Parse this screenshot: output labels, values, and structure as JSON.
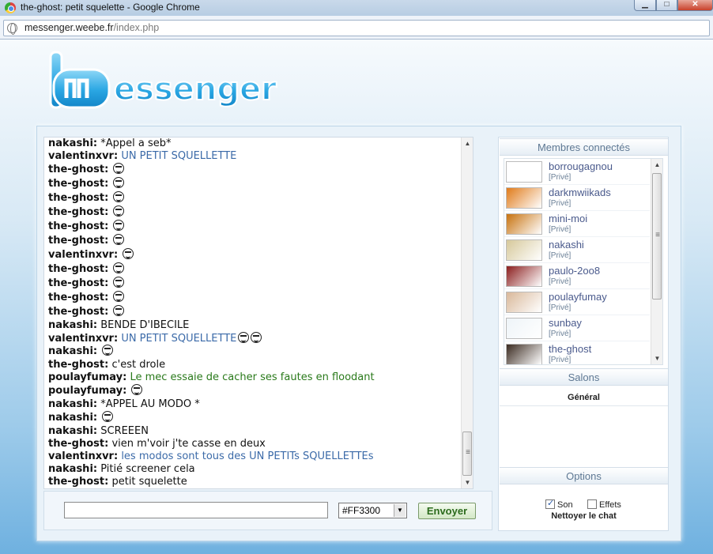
{
  "window": {
    "title": "the-ghost: petit squelette - Google Chrome",
    "minimize": "▁",
    "maximize": "□",
    "close": "✕"
  },
  "browser": {
    "url_host": "messenger.weebe.fr",
    "url_path": "/index.php"
  },
  "logo": {
    "text": "Messenger"
  },
  "chat": {
    "lines": [
      {
        "user": "nakashi:",
        "msg": "*Appel a seb*",
        "style": "",
        "smileys": 0
      },
      {
        "user": "valentinxvr:",
        "msg": "UN PETIT SQUELLETTE",
        "style": "blue",
        "smileys": 0
      },
      {
        "user": "the-ghost:",
        "msg": "",
        "style": "",
        "smileys": 1
      },
      {
        "user": "the-ghost:",
        "msg": "",
        "style": "",
        "smileys": 1
      },
      {
        "user": "the-ghost:",
        "msg": "",
        "style": "",
        "smileys": 1
      },
      {
        "user": "the-ghost:",
        "msg": "",
        "style": "",
        "smileys": 1
      },
      {
        "user": "the-ghost:",
        "msg": "",
        "style": "",
        "smileys": 1
      },
      {
        "user": "the-ghost:",
        "msg": "",
        "style": "",
        "smileys": 1
      },
      {
        "user": "valentinxvr:",
        "msg": "",
        "style": "",
        "smileys": 1
      },
      {
        "user": "the-ghost:",
        "msg": "",
        "style": "",
        "smileys": 1
      },
      {
        "user": "the-ghost:",
        "msg": "",
        "style": "",
        "smileys": 1
      },
      {
        "user": "the-ghost:",
        "msg": "",
        "style": "",
        "smileys": 1
      },
      {
        "user": "the-ghost:",
        "msg": "",
        "style": "",
        "smileys": 1
      },
      {
        "user": "nakashi:",
        "msg": "BENDE D'IBECILE",
        "style": "",
        "smileys": 0
      },
      {
        "user": "valentinxvr:",
        "msg": "UN PETIT SQUELLETTE",
        "style": "blue",
        "smileys": 2
      },
      {
        "user": "nakashi:",
        "msg": "",
        "style": "",
        "smileys": 1
      },
      {
        "user": "the-ghost:",
        "msg": "c'est drole",
        "style": "",
        "smileys": 0
      },
      {
        "user": "poulayfumay:",
        "msg": "Le mec essaie de cacher ses fautes en floodant",
        "style": "green",
        "smileys": 0
      },
      {
        "user": "poulayfumay:",
        "msg": "",
        "style": "",
        "smileys": 1
      },
      {
        "user": "nakashi:",
        "msg": "*APPEL AU MODO *",
        "style": "",
        "smileys": 0
      },
      {
        "user": "nakashi:",
        "msg": "",
        "style": "",
        "smileys": 1
      },
      {
        "user": "nakashi:",
        "msg": "SCREEEN",
        "style": "",
        "smileys": 0
      },
      {
        "user": "the-ghost:",
        "msg": "vien m'voir j'te casse en deux",
        "style": "",
        "smileys": 0
      },
      {
        "user": "valentinxvr:",
        "msg": "les modos sont tous des UN PETITs SQUELLETTEs",
        "style": "blue",
        "smileys": 0
      },
      {
        "user": "nakashi:",
        "msg": "Pitié screener cela",
        "style": "",
        "smileys": 0
      },
      {
        "user": "the-ghost:",
        "msg": "petit squelette",
        "style": "",
        "smileys": 0
      }
    ]
  },
  "composer": {
    "message_value": "",
    "color_value": "#FF3300",
    "send_label": "Envoyer"
  },
  "sidebar": {
    "members_title": "Membres connectés",
    "members": [
      {
        "name": "borrougagnou",
        "tag": "[Privé]",
        "color": "#ffffff"
      },
      {
        "name": "darkmwiikads",
        "tag": "[Privé]",
        "color": "#e07b1a"
      },
      {
        "name": "mini-moi",
        "tag": "[Privé]",
        "color": "#c7720f"
      },
      {
        "name": "nakashi",
        "tag": "[Privé]",
        "color": "#d6c89a"
      },
      {
        "name": "paulo-2oo8",
        "tag": "[Privé]",
        "color": "#8b1e1e"
      },
      {
        "name": "poulayfumay",
        "tag": "[Privé]",
        "color": "#d9b89a"
      },
      {
        "name": "sunbay",
        "tag": "[Privé]",
        "color": "#eef4f8"
      },
      {
        "name": "the-ghost",
        "tag": "[Privé]",
        "color": "#3a2a20"
      }
    ],
    "salons_title": "Salons",
    "salon_current": "Général",
    "options_title": "Options",
    "son_label": "Son",
    "son_checked": true,
    "effets_label": "Effets",
    "effets_checked": false,
    "clear_chat": "Nettoyer le chat"
  },
  "colors": {
    "accent_blue": "#3b6aa8",
    "accent_green": "#2a7a1b"
  }
}
